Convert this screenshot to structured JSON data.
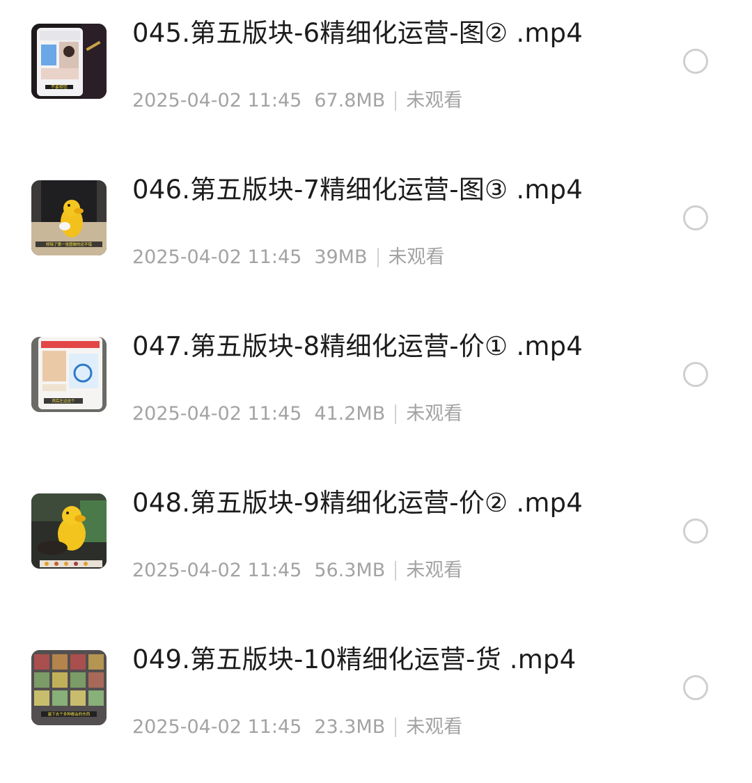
{
  "files": [
    {
      "title": "045.第五版块-6精细化运营-图② .mp4",
      "date": "2025-04-02 11:45",
      "size": "67.8MB",
      "status": "未观看",
      "thumb_icon": "video-thumbnail-phone-screen",
      "thumb_caption": "不要相信"
    },
    {
      "title": "046.第五版块-7精细化运营-图③ .mp4",
      "date": "2025-04-02 11:45",
      "size": "39MB",
      "status": "未观看",
      "thumb_icon": "video-thumbnail-yellow-toy",
      "thumb_caption": "修除了第一张图做的还不错"
    },
    {
      "title": "047.第五版块-8精细化运营-价① .mp4",
      "date": "2025-04-02 11:45",
      "size": "41.2MB",
      "status": "未观看",
      "thumb_icon": "video-thumbnail-phone-screen",
      "thumb_caption": "然后左边这个"
    },
    {
      "title": "048.第五版块-9精细化运营-价② .mp4",
      "date": "2025-04-02 11:45",
      "size": "56.3MB",
      "status": "未观看",
      "thumb_icon": "video-thumbnail-yellow-toy",
      "thumb_caption": ""
    },
    {
      "title": "049.第五版块-10精细化运营-货 .mp4",
      "date": "2025-04-02 11:45",
      "size": "23.3MB",
      "status": "未观看",
      "thumb_icon": "video-thumbnail-product-grid",
      "thumb_caption": "最下去个多种都会的东西"
    }
  ],
  "colors": {
    "title": "#1c1c1c",
    "meta": "#a3a3a3",
    "radio_border": "#cfcfcf"
  }
}
